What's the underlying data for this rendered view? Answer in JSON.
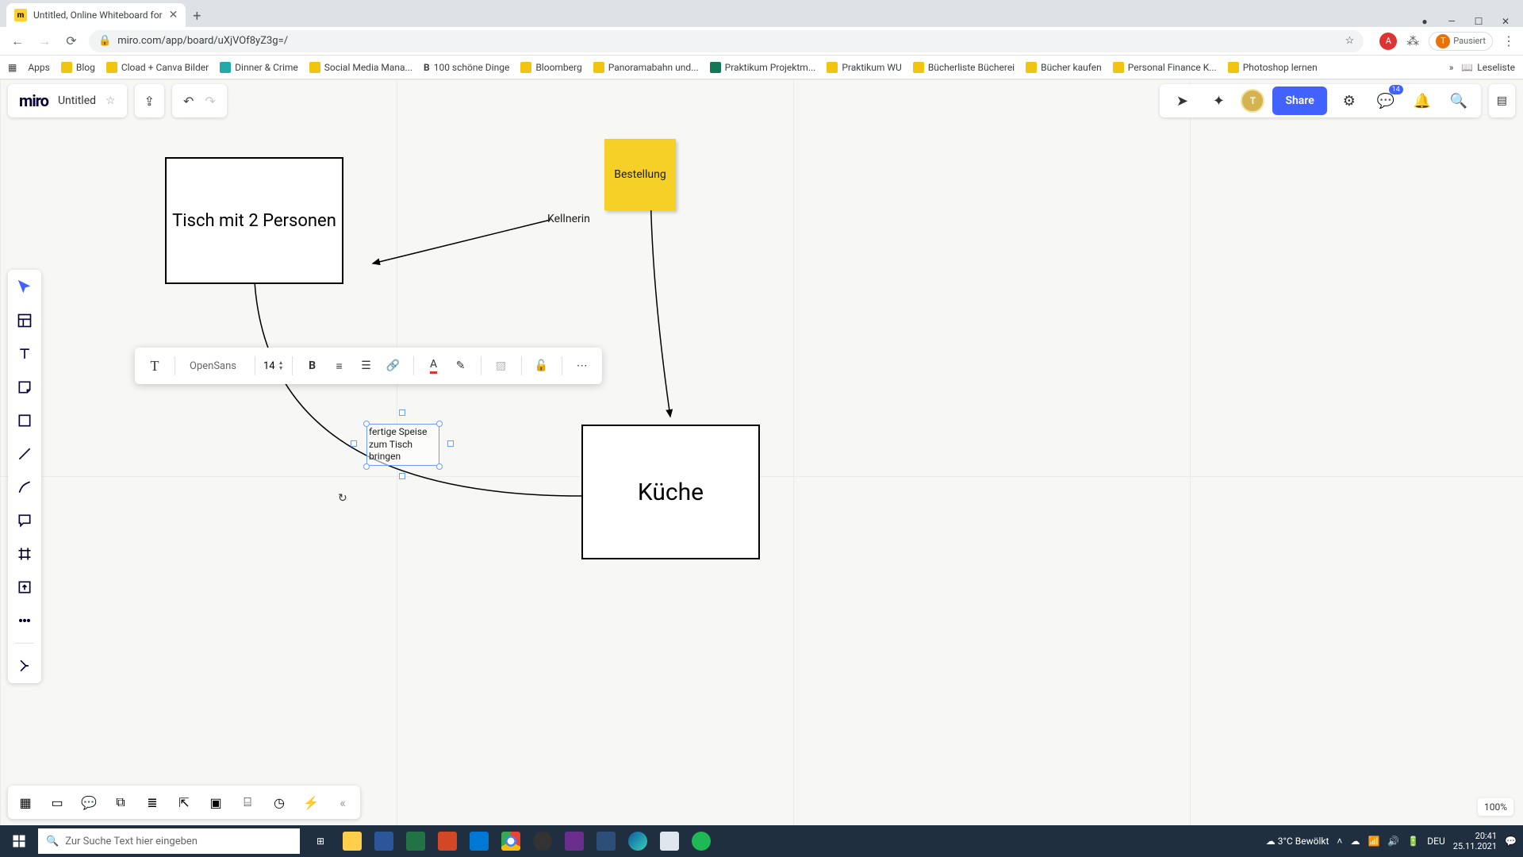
{
  "browser": {
    "tab_title": "Untitled, Online Whiteboard for",
    "url": "miro.com/app/board/uXjVOf8yZ3g=/",
    "profile_state": "Pausiert",
    "bookmarks": [
      "Apps",
      "Blog",
      "Cload + Canva Bilder",
      "Dinner & Crime",
      "Social Media Mana...",
      "100 schöne Dinge",
      "Bloomberg",
      "Panoramabahn und...",
      "Praktikum Projektm...",
      "Praktikum WU",
      "Bücherliste Bücherei",
      "Bücher kaufen",
      "Personal Finance K...",
      "Photoshop lernen"
    ],
    "bookmarks_overflow": "»",
    "reading_list": "Leseliste"
  },
  "miro": {
    "logo": "miro",
    "board_title": "Untitled",
    "share": "Share",
    "avatar": "T",
    "notif_badge": "14",
    "zoom": "100%"
  },
  "canvas": {
    "box_table": "Tisch mit 2 Personen",
    "box_kitchen": "Küche",
    "sticky_order": "Bestellung",
    "label_waiter": "Kellnerin",
    "sel_text": "fertige Speise zum Tisch bringen"
  },
  "txtbar": {
    "font": "OpenSans",
    "size": "14",
    "bold": "B"
  },
  "taskbar": {
    "search_placeholder": "Zur Suche Text hier eingeben",
    "weather": "3°C  Bewölkt",
    "time": "20:41",
    "date": "25.11.2021",
    "lang": "DEU"
  }
}
